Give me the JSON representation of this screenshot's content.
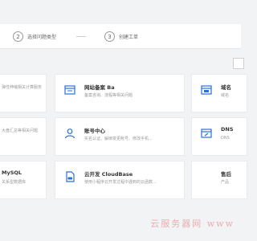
{
  "steps": [
    {
      "number": "2",
      "label": "选择问题类型"
    },
    {
      "number": "3",
      "label": "创建工单"
    }
  ],
  "cards": {
    "row1_left_desc": "弹性伸缩相关计算服务",
    "row1_mid": {
      "title": "网站备案 Ba",
      "desc": "备案咨询、流程等相关问题"
    },
    "row1_right_title": "域名",
    "row1_right_desc": "域名",
    "row2_left_desc": "大盘汇总等相关问题",
    "row2_mid": {
      "title": "账号中心",
      "desc": "实名认证、解绑变更账号、修改手机..."
    },
    "row2_right_title": "DNS",
    "row2_right_desc": "DNS",
    "row3_left_title": "MySQL",
    "row3_left_desc": "关系型数据库",
    "row3_mid": {
      "title": "云开发 CloudBase",
      "desc": "使用小程序云开发过程中遇到的云函数..."
    },
    "row3_right_title": "售后",
    "row3_right_desc": "产品"
  },
  "icons": {
    "website": "browser-window-icon",
    "account": "user-icon",
    "cloudbase": "document-cloud-icon",
    "domain": "web-page-icon",
    "dns": "dns-window-icon"
  },
  "colors": {
    "accent": "#2a6fd6"
  },
  "watermark": "云服务器网 www"
}
